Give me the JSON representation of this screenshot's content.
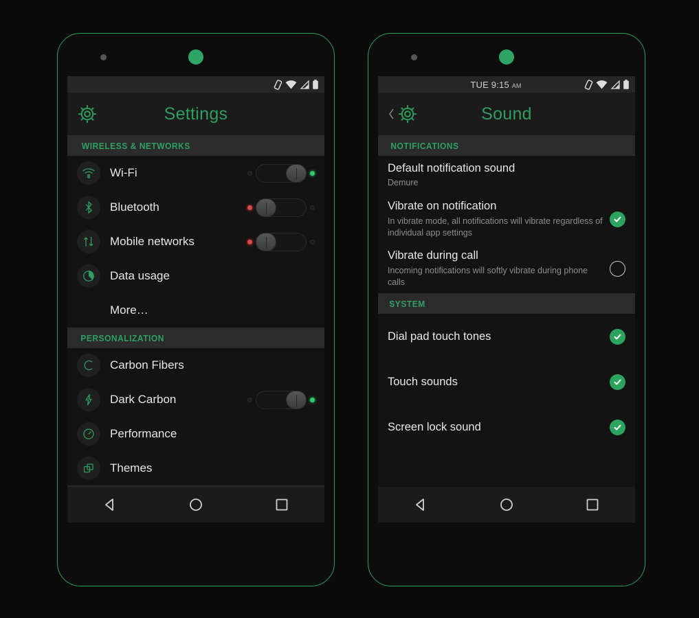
{
  "accent_green": "#2e9d5e",
  "led_green": "#2fcc6a",
  "led_red": "#e04545",
  "phones": [
    {
      "name": "settings-phone",
      "statusbar": {
        "clock": "",
        "ampm": "",
        "icons": [
          "vibrate-icon",
          "wifi-icon",
          "signal-icon",
          "battery-icon"
        ]
      },
      "actionbar": {
        "title": "Settings",
        "has_back": false,
        "gear": "gear-icon"
      },
      "sections": [
        {
          "header": "WIRELESS & NETWORKS",
          "rows": [
            {
              "icon": "wifi-icon",
              "label": "Wi-Fi",
              "control": "toggle",
              "state": "on"
            },
            {
              "icon": "bluetooth-icon",
              "label": "Bluetooth",
              "control": "toggle",
              "state": "off"
            },
            {
              "icon": "data-arrows-icon",
              "label": "Mobile networks",
              "control": "toggle",
              "state": "off"
            },
            {
              "icon": "pie-chart-icon",
              "label": "Data usage",
              "control": "none",
              "state": ""
            },
            {
              "icon": "none",
              "label": "More…",
              "control": "none",
              "state": ""
            }
          ]
        },
        {
          "header": "PERSONALIZATION",
          "rows": [
            {
              "icon": "carbon-c-icon",
              "label": "Carbon Fibers",
              "control": "none",
              "state": ""
            },
            {
              "icon": "bolt-icon",
              "label": "Dark Carbon",
              "control": "toggle",
              "state": "on"
            },
            {
              "icon": "gauge-icon",
              "label": "Performance",
              "control": "none",
              "state": ""
            },
            {
              "icon": "layers-icon",
              "label": "Themes",
              "control": "none",
              "state": ""
            }
          ]
        }
      ],
      "navbar": [
        "back-icon",
        "home-icon",
        "recents-icon"
      ]
    },
    {
      "name": "sound-phone",
      "statusbar": {
        "clock": "TUE 9:15",
        "ampm": "AM",
        "icons": [
          "vibrate-icon",
          "wifi-icon",
          "signal-icon",
          "battery-icon"
        ]
      },
      "actionbar": {
        "title": "Sound",
        "has_back": true,
        "gear": "gear-icon"
      },
      "sections": [
        {
          "header": "NOTIFICATIONS",
          "rows": [
            {
              "title": "Default notification sound",
              "sub": "Demure",
              "control": "none",
              "state": ""
            },
            {
              "title": "Vibrate on notification",
              "sub": "In vibrate mode, all notifications will vibrate regardless of individual app settings",
              "control": "checkbox",
              "state": "checked"
            },
            {
              "title": "Vibrate during call",
              "sub": "Incoming notifications will softly vibrate during phone calls",
              "control": "checkbox",
              "state": "unchecked"
            }
          ]
        },
        {
          "header": "SYSTEM",
          "rows": [
            {
              "title": "Dial pad touch tones",
              "sub": "",
              "control": "checkbox",
              "state": "checked"
            },
            {
              "title": "Touch sounds",
              "sub": "",
              "control": "checkbox",
              "state": "checked"
            },
            {
              "title": "Screen lock sound",
              "sub": "",
              "control": "checkbox",
              "state": "checked"
            }
          ]
        }
      ],
      "navbar": [
        "back-icon",
        "home-icon",
        "recents-icon"
      ]
    }
  ]
}
